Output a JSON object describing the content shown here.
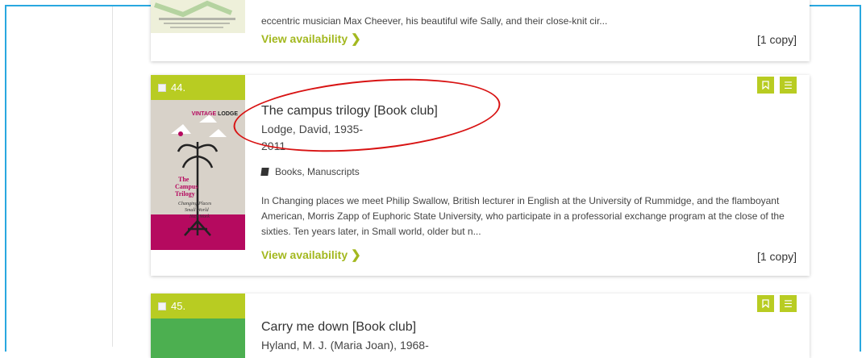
{
  "colors": {
    "accent": "#b8cc22",
    "link": "#a3b81f",
    "annotation": "#d81313",
    "frame": "#29a8e0"
  },
  "icons": {
    "bookmark": "bookmark-icon",
    "menu": "menu-icon",
    "chevron": "chevron-right-icon",
    "book": "book-icon"
  },
  "results": [
    {
      "description_tail": "eccentric musician Max Cheever, his beautiful wife Sally, and their close-knit cir...",
      "view_availability": "View availability",
      "copies": "[1 copy]"
    },
    {
      "number": "44.",
      "cover_brand": "VINTAGE LODGE",
      "cover_title": "The Campus Trilogy",
      "title": "The campus trilogy [Book club]",
      "author_line1": "Lodge, David, 1935-",
      "author_line2": "2011",
      "type": "Books, Manuscripts",
      "description": "In Changing places we meet Philip Swallow, British lecturer in English at the University of Rummidge, and the flamboyant American, Morris Zapp of Euphoric State University, who participate in a professorial exchange program at the close of the sixties. Ten years later, in Small world, older but n...",
      "view_availability": "View availability",
      "copies": "[1 copy]"
    },
    {
      "number": "45.",
      "title": "Carry me down [Book club]",
      "author_line1": "Hyland, M. J. (Maria Joan), 1968-"
    }
  ]
}
